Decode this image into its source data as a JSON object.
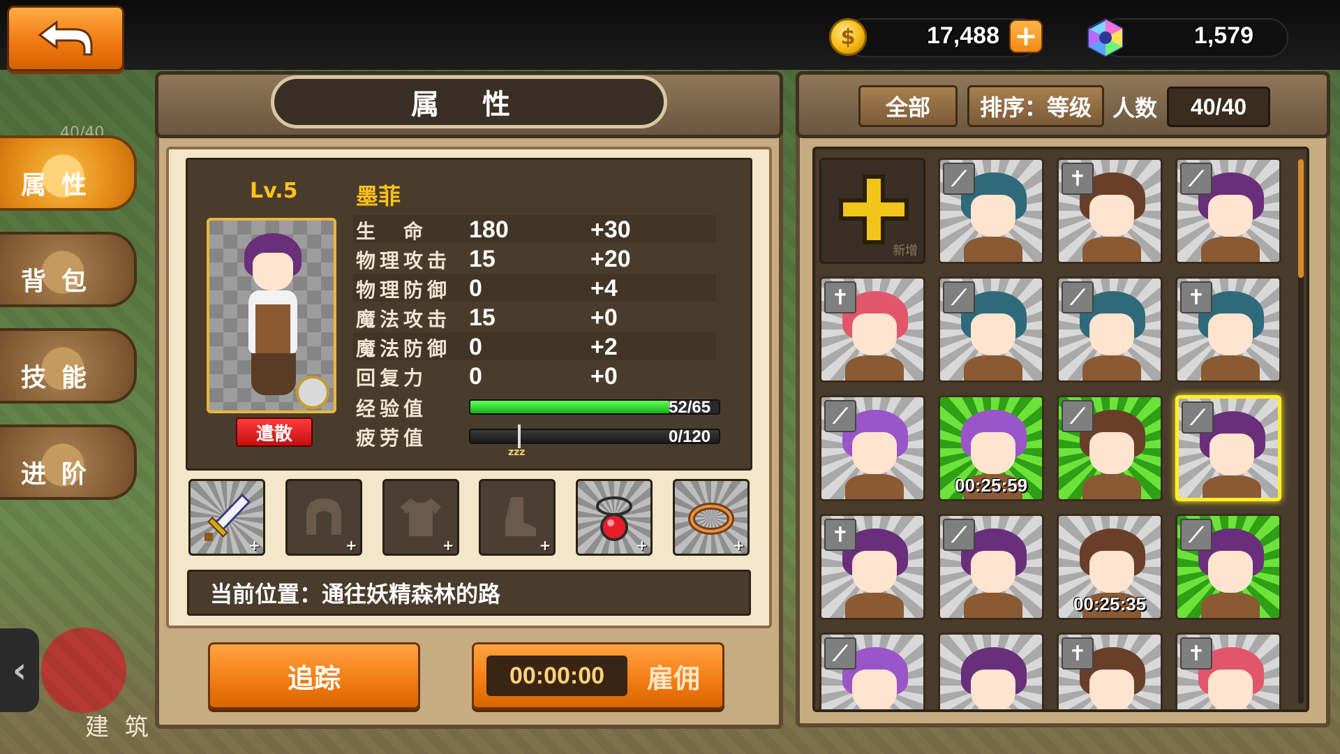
{
  "currency": {
    "gold": "17,488",
    "gems": "1,579"
  },
  "side_tabs": [
    {
      "label": "属性",
      "active": true
    },
    {
      "label": "背包",
      "active": false
    },
    {
      "label": "技能",
      "active": false
    },
    {
      "label": "进阶",
      "active": false
    }
  ],
  "background": {
    "counter": "40/40",
    "building": "建 筑"
  },
  "panel_title": "属 性",
  "hero": {
    "level": "Lv.5",
    "name": "墨菲",
    "dismiss": "遣散",
    "stats": [
      {
        "label": "生　命",
        "value": "180",
        "bonus": "+30"
      },
      {
        "label": "物理攻击",
        "value": "15",
        "bonus": "+20"
      },
      {
        "label": "物理防御",
        "value": "0",
        "bonus": "+4"
      },
      {
        "label": "魔法攻击",
        "value": "15",
        "bonus": "+0"
      },
      {
        "label": "魔法防御",
        "value": "0",
        "bonus": "+2"
      },
      {
        "label": "回复力",
        "value": "0",
        "bonus": "+0"
      }
    ],
    "exp": {
      "label": "经验值",
      "text": "52/65",
      "fraction": 0.8
    },
    "fatigue": {
      "label": "疲劳值",
      "text": "0/120",
      "fraction": 0.0,
      "marker": "zzz"
    },
    "location": "当前位置：通往妖精森林的路"
  },
  "equipment": [
    {
      "name": "sword",
      "equipped": true
    },
    {
      "name": "helmet",
      "equipped": false
    },
    {
      "name": "armor",
      "equipped": false
    },
    {
      "name": "boots",
      "equipped": false
    },
    {
      "name": "amulet",
      "equipped": true
    },
    {
      "name": "ring",
      "equipped": true
    }
  ],
  "actions": {
    "track": "追踪",
    "timer": "00:00:00",
    "hire": "雇佣"
  },
  "roster": {
    "filter": "全部",
    "sort": "排序：等级",
    "count_label": "人数",
    "count": "40/40",
    "add_label": "新增",
    "heroes": [
      {
        "class": "sword",
        "hair": "#2f6a7a",
        "bg": "gray",
        "timer": ""
      },
      {
        "class": "cross",
        "hair": "#6a3f2a",
        "bg": "gray",
        "timer": ""
      },
      {
        "class": "sword",
        "hair": "#6a2f7a",
        "bg": "gray",
        "timer": ""
      },
      {
        "class": "cross",
        "hair": "#e2566c",
        "bg": "gray",
        "timer": ""
      },
      {
        "class": "sword",
        "hair": "#2f6a7a",
        "bg": "gray",
        "timer": ""
      },
      {
        "class": "sword",
        "hair": "#2f6a7a",
        "bg": "gray",
        "timer": ""
      },
      {
        "class": "cross",
        "hair": "#2f6a7a",
        "bg": "gray",
        "timer": ""
      },
      {
        "class": "sword",
        "hair": "#9a55c8",
        "bg": "gray",
        "timer": ""
      },
      {
        "class": "",
        "hair": "#9a55c8",
        "bg": "green",
        "timer": "00:25:59"
      },
      {
        "class": "sword",
        "hair": "#6a3f2a",
        "bg": "green",
        "timer": ""
      },
      {
        "class": "sword",
        "hair": "#6a2f7a",
        "bg": "gray",
        "timer": "",
        "selected": true
      },
      {
        "class": "cross",
        "hair": "#6a2f7a",
        "bg": "gray",
        "timer": ""
      },
      {
        "class": "sword",
        "hair": "#6a2f7a",
        "bg": "gray",
        "timer": ""
      },
      {
        "class": "",
        "hair": "#6a3f2a",
        "bg": "gray",
        "timer": "00:25:35"
      },
      {
        "class": "sword",
        "hair": "#6a2f7a",
        "bg": "green",
        "timer": ""
      },
      {
        "class": "sword",
        "hair": "#9a55c8",
        "bg": "gray",
        "timer": ""
      },
      {
        "class": "",
        "hair": "#6a2f7a",
        "bg": "gray",
        "timer": ""
      },
      {
        "class": "cross",
        "hair": "#6a3f2a",
        "bg": "gray",
        "timer": ""
      },
      {
        "class": "cross",
        "hair": "#e2566c",
        "bg": "gray",
        "timer": ""
      }
    ]
  }
}
